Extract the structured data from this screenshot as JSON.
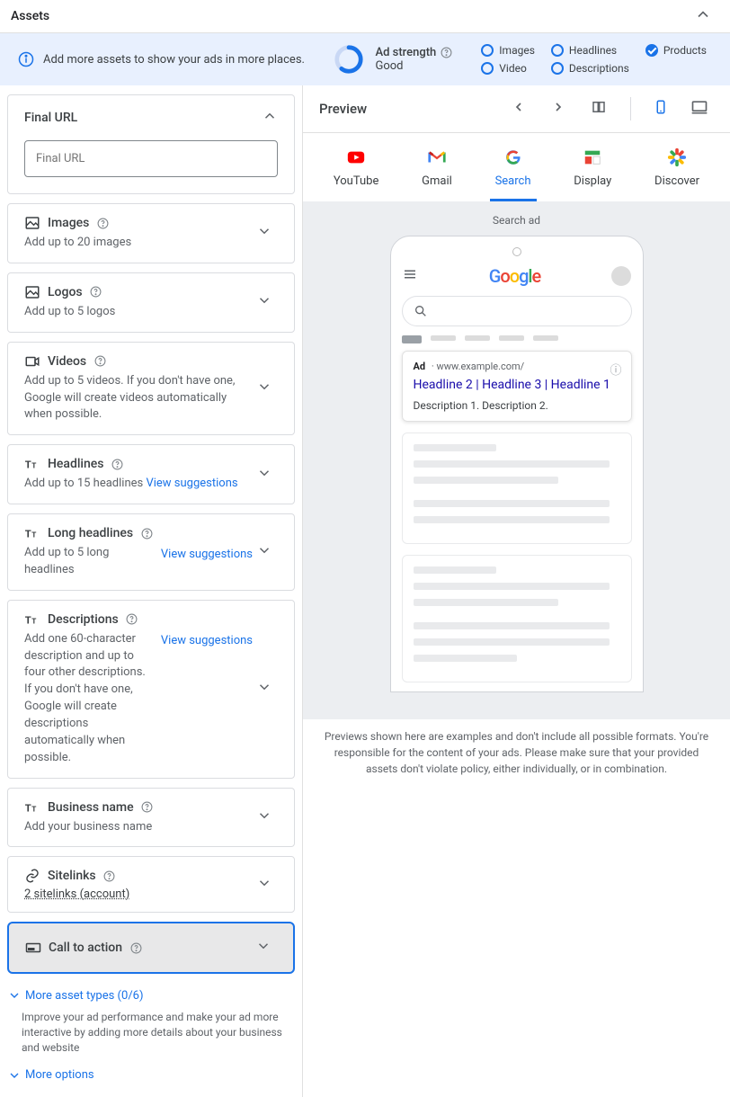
{
  "header": {
    "title": "Assets"
  },
  "info_bar": {
    "message": "Add more assets to show your ads in more places.",
    "strength_label": "Ad strength",
    "strength_value": "Good",
    "checks": [
      {
        "label": "Images",
        "done": false
      },
      {
        "label": "Headlines",
        "done": false
      },
      {
        "label": "Products",
        "done": true
      },
      {
        "label": "Video",
        "done": false
      },
      {
        "label": "Descriptions",
        "done": false
      }
    ]
  },
  "final_url": {
    "label": "Final URL",
    "placeholder": "Final URL"
  },
  "assets": {
    "images": {
      "title": "Images",
      "sub": "Add up to 20 images"
    },
    "logos": {
      "title": "Logos",
      "sub": "Add up to 5 logos"
    },
    "videos": {
      "title": "Videos",
      "sub": "Add up to 5 videos. If you don't have one, Google will create videos automatically when possible."
    },
    "headlines": {
      "title": "Headlines",
      "sub": "Add up to 15 headlines",
      "suggest": "View suggestions"
    },
    "long_headlines": {
      "title": "Long headlines",
      "sub": "Add up to 5 long headlines",
      "suggest": "View suggestions"
    },
    "descriptions": {
      "title": "Descriptions",
      "sub": "Add one 60-character description and up to four other descriptions. If you don't have one, Google will create descriptions automatically when possible.",
      "suggest": "View suggestions"
    },
    "business": {
      "title": "Business name",
      "sub": "Add your business name"
    },
    "sitelinks": {
      "title": "Sitelinks",
      "link": "2 sitelinks (account)"
    },
    "cta": {
      "title": "Call to action"
    }
  },
  "more": {
    "asset_types": "More asset types (0/6)",
    "asset_desc": "Improve your ad performance and make your ad more interactive by adding more details about your business and website",
    "options": "More options"
  },
  "preview": {
    "title": "Preview",
    "channels": [
      "YouTube",
      "Gmail",
      "Search",
      "Display",
      "Discover"
    ],
    "stage_label": "Search ad",
    "ad": {
      "badge": "Ad",
      "url": "www.example.com/",
      "headline": "Headline 2 | Headline 3 | Headline 1",
      "description": "Description 1. Description 2."
    },
    "disclaimer": "Previews shown here are examples and don't include all possible formats. You're responsible for the content of your ads. Please make sure that your provided assets don't violate policy, either individually, or in combination."
  }
}
